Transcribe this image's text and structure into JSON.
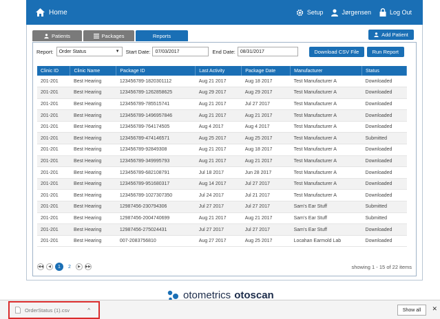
{
  "nav": {
    "home_label": "Home",
    "setup_label": "Setup",
    "user_label": "Jørgensen",
    "logout_label": "Log Out"
  },
  "tabs": [
    {
      "label": "Patients",
      "icon": "user-icon"
    },
    {
      "label": "Packages",
      "icon": "list-icon"
    },
    {
      "label": "Reports",
      "icon": "",
      "active": true
    }
  ],
  "add_patient_label": "Add Patient",
  "filters": {
    "report_label": "Report:",
    "report_value": "Order Status",
    "start_label": "Start Date:",
    "start_value": "07/03/2017",
    "end_label": "End Date:",
    "end_value": "08/31/2017",
    "download_label": "Download CSV File",
    "run_label": "Run Report"
  },
  "table": {
    "columns": [
      "Clinic ID",
      "Clinic Name",
      "Package ID",
      "Last Activity",
      "Package Date",
      "Manufacturer",
      "Status"
    ],
    "rows": [
      [
        "201-201",
        "Best Hearing",
        "123456789-1820301112",
        "Aug 21 2017",
        "Aug 18 2017",
        "Test Manufacturer A",
        "Downloaded"
      ],
      [
        "201-201",
        "Best Hearing",
        "123456789-1262858625",
        "Aug 29 2017",
        "Aug 29 2017",
        "Test Manufacturer A",
        "Downloaded"
      ],
      [
        "201-201",
        "Best Hearing",
        "123456789-785515741",
        "Aug 21 2017",
        "Jul 27 2017",
        "Test Manufacturer A",
        "Downloaded"
      ],
      [
        "201-201",
        "Best Hearing",
        "123456789-1496957846",
        "Aug 21 2017",
        "Aug 21 2017",
        "Test Manufacturer A",
        "Downloaded"
      ],
      [
        "201-201",
        "Best Hearing",
        "123456789-764174505",
        "Aug 4 2017",
        "Aug 4 2017",
        "Test Manufacturer A",
        "Downloaded"
      ],
      [
        "201-201",
        "Best Hearing",
        "123456789-474146571",
        "Aug 25 2017",
        "Aug 25 2017",
        "Test Manufacturer A",
        "Submitted"
      ],
      [
        "201-201",
        "Best Hearing",
        "123456789-92849308",
        "Aug 21 2017",
        "Aug 18 2017",
        "Test Manufacturer A",
        "Downloaded"
      ],
      [
        "201-201",
        "Best Hearing",
        "123456789-349995793",
        "Aug 21 2017",
        "Aug 21 2017",
        "Test Manufacturer A",
        "Downloaded"
      ],
      [
        "201-201",
        "Best Hearing",
        "123456789-682108791",
        "Jul 18 2017",
        "Jun 28 2017",
        "Test Manufacturer A",
        "Downloaded"
      ],
      [
        "201-201",
        "Best Hearing",
        "123456789-951680317",
        "Aug 14 2017",
        "Jul 27 2017",
        "Test Manufacturer A",
        "Downloaded"
      ],
      [
        "201-201",
        "Best Hearing",
        "123456789-1027307350",
        "Jul 24 2017",
        "Jul 21 2017",
        "Test Manufacturer A",
        "Downloaded"
      ],
      [
        "201-201",
        "Best Hearing",
        "12987456-230794306",
        "Jul 27 2017",
        "Jul 27 2017",
        "Sam's Ear Stuff",
        "Submitted"
      ],
      [
        "201-201",
        "Best Hearing",
        "12987456-2004740699",
        "Aug 21 2017",
        "Aug 21 2017",
        "Sam's Ear Stuff",
        "Submitted"
      ],
      [
        "201-201",
        "Best Hearing",
        "12987456-275024431",
        "Jul 27 2017",
        "Jul 27 2017",
        "Sam's Ear Stuff",
        "Downloaded"
      ],
      [
        "201-201",
        "Best Hearing",
        "007-2083756810",
        "Aug 27 2017",
        "Aug 25 2017",
        "Locahan Earmold Lab",
        "Downloaded"
      ]
    ]
  },
  "pager": {
    "pages": [
      "1",
      "2"
    ],
    "current": "1",
    "info": "showing 1 - 15 of 22 items"
  },
  "brand": {
    "name_light": "otometrics",
    "name_bold": "otoscan"
  },
  "downloads": {
    "file_name": "OrderStatus (1).csv",
    "show_all_label": "Show all"
  },
  "colors": {
    "primary": "#1a6fb5",
    "tab_inactive": "#7a7a7a",
    "highlight_border": "#d92b2b"
  }
}
